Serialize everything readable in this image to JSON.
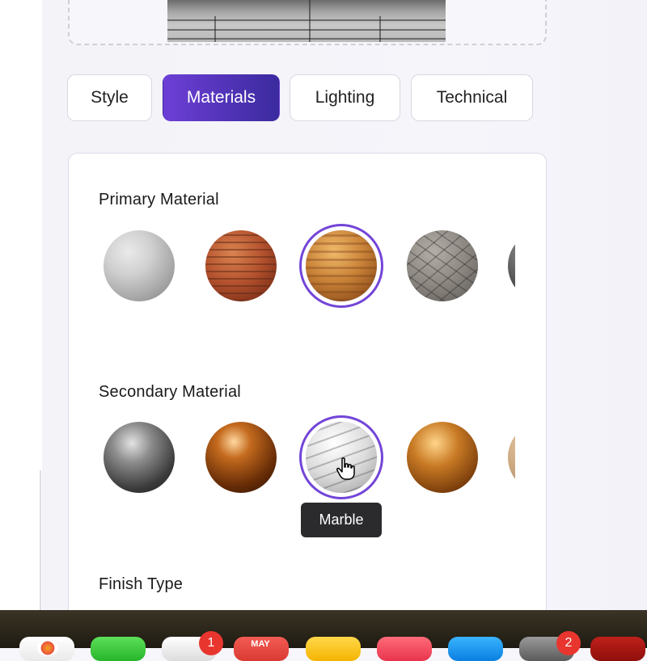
{
  "tabs": [
    {
      "label": "Style",
      "active": false
    },
    {
      "label": "Materials",
      "active": true
    },
    {
      "label": "Lighting",
      "active": false
    },
    {
      "label": "Technical",
      "active": false
    }
  ],
  "sections": {
    "primary": {
      "label": "Primary Material",
      "swatches": [
        "concrete",
        "brick",
        "wood",
        "stone",
        "dark-metal"
      ],
      "selected_index": 2
    },
    "secondary": {
      "label": "Secondary Material",
      "swatches": [
        "steel",
        "copper",
        "marble",
        "bronze",
        "ash-wood"
      ],
      "selected_index": 2
    },
    "finish": {
      "label": "Finish Type"
    }
  },
  "tooltip": {
    "text": "Marble"
  },
  "accent_color": "#7345d8",
  "dock": {
    "calendar_month": "MAY",
    "badges": {
      "mail": "1",
      "settings": "2"
    }
  }
}
